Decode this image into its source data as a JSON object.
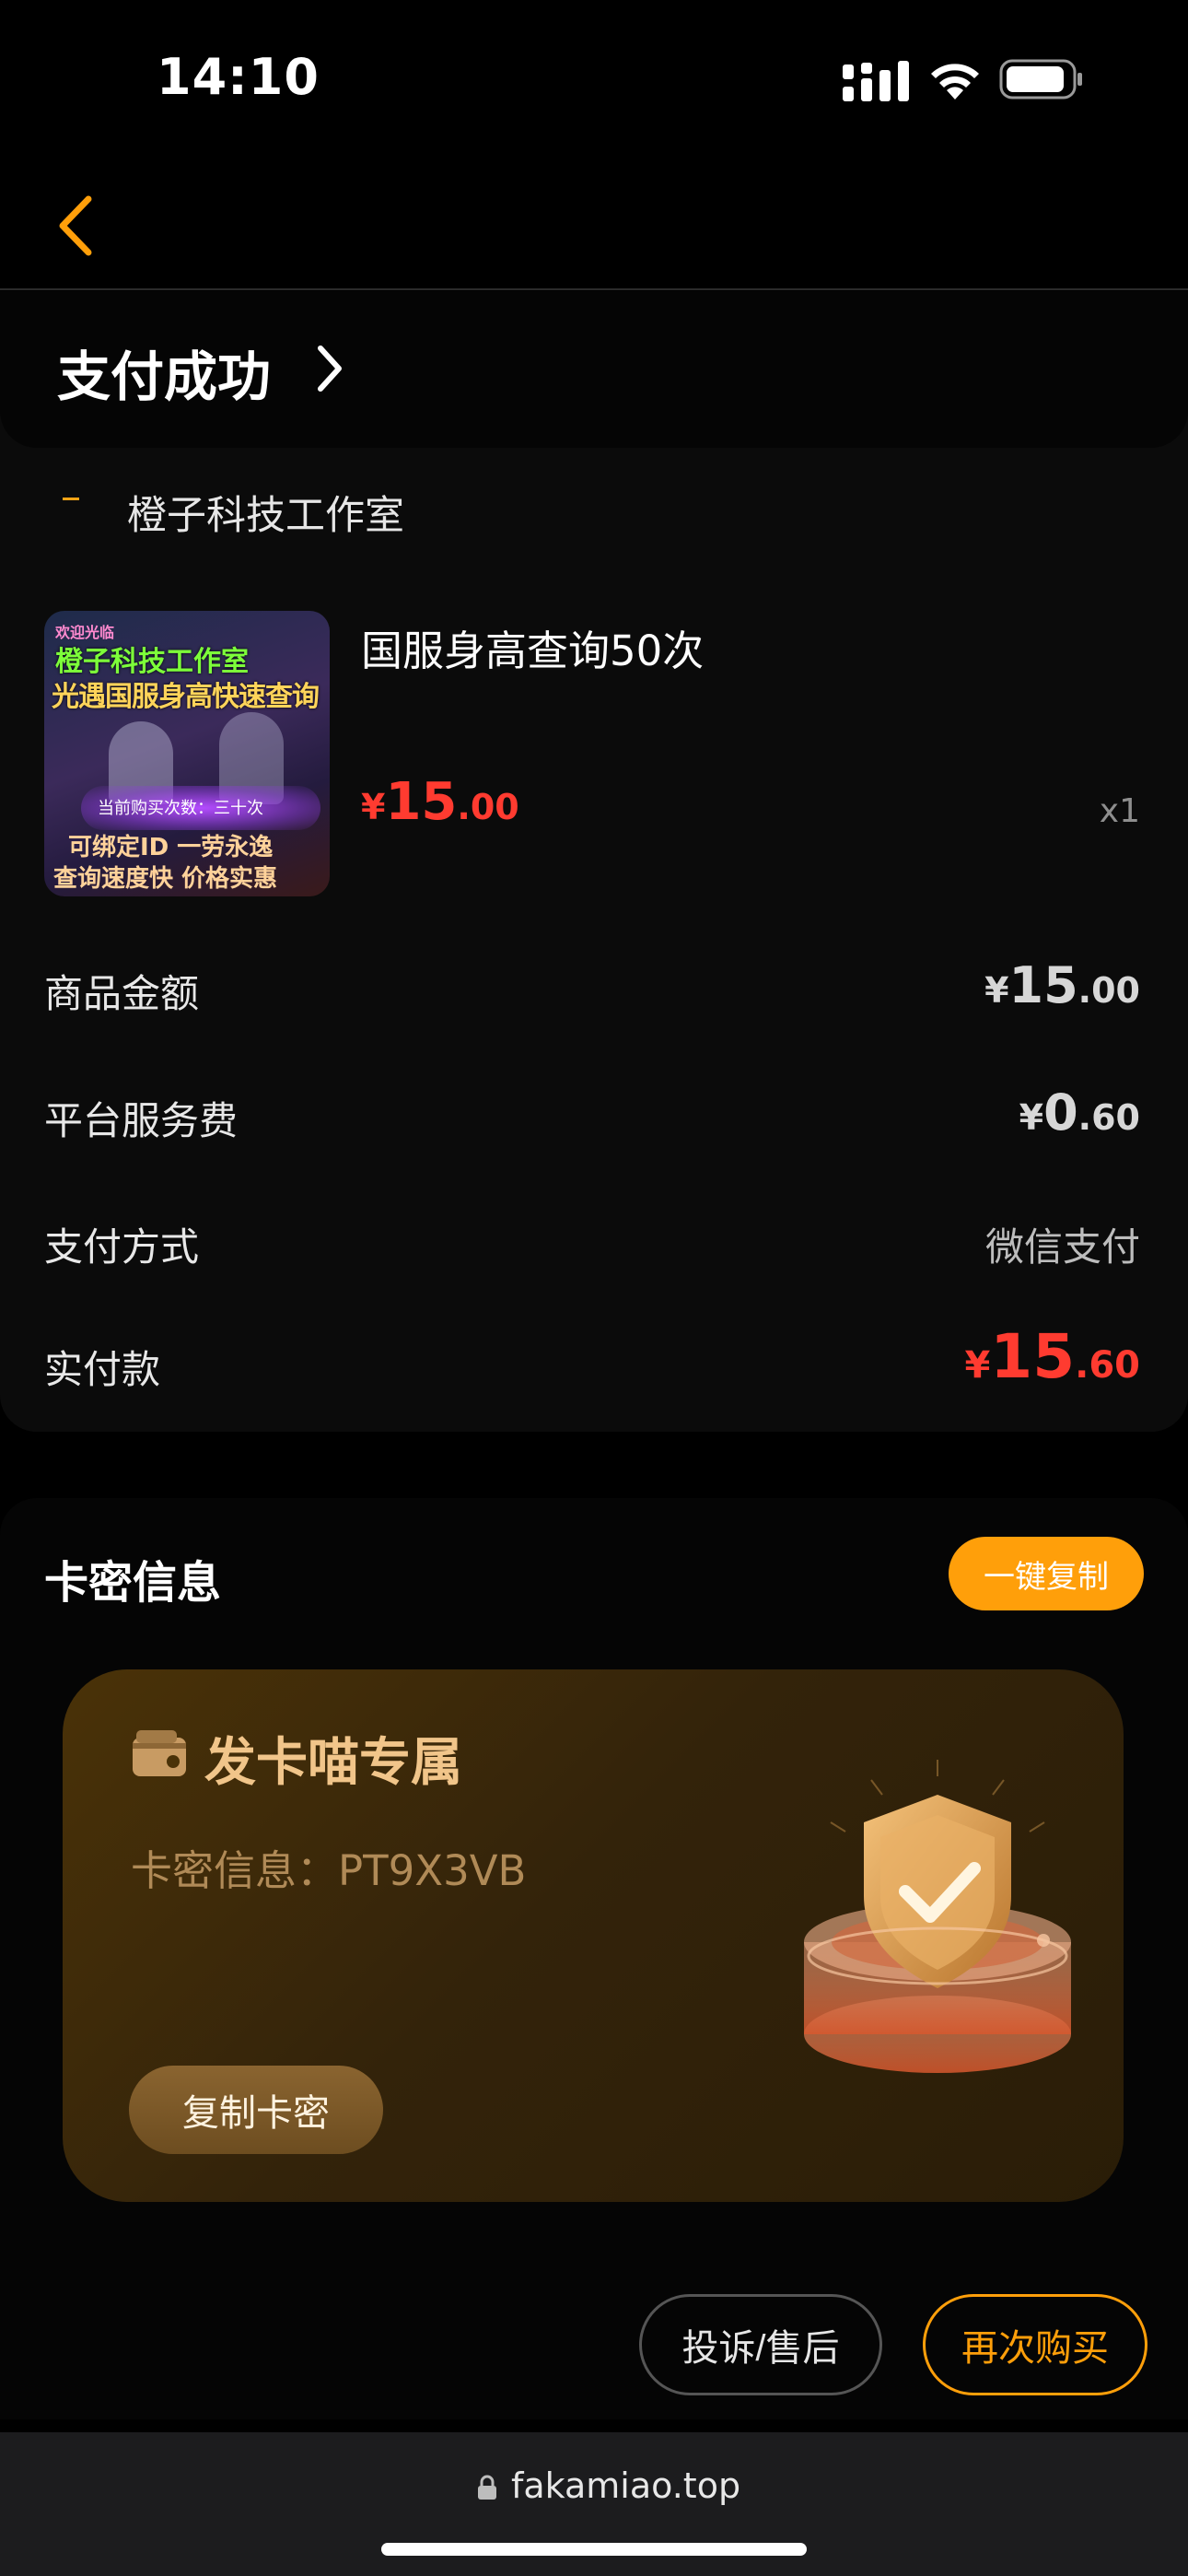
{
  "status_bar": {
    "time": "14:10"
  },
  "nav": {
    "back_icon": "chevron-left-icon"
  },
  "order": {
    "status_title": "支付成功",
    "shop_name": "橙子科技工作室",
    "product": {
      "image_text": {
        "welcome": "欢迎光临",
        "studio": "橙子科技工作室",
        "headline": "光遇国服身高快速查询",
        "remaining": "当前购买次数：三十次",
        "feature1": "可绑定ID 一劳永逸",
        "feature2": "查询速度快 价格实惠"
      },
      "name": "国服身高查询50次",
      "price_symbol": "¥",
      "price_int": "15",
      "price_dec": ".00",
      "qty": "x1"
    },
    "rows": {
      "goods_amount": {
        "label": "商品金额",
        "symbol": "¥",
        "int": "15",
        "dec": ".00"
      },
      "service_fee": {
        "label": "平台服务费",
        "symbol": "¥",
        "int": "0",
        "dec": ".60"
      },
      "pay_method": {
        "label": "支付方式",
        "value": "微信支付"
      },
      "paid": {
        "label": "实付款",
        "symbol": "¥",
        "int": "15",
        "dec": ".60"
      }
    }
  },
  "card_info": {
    "title": "卡密信息",
    "copy_all": "一键复制",
    "voucher": {
      "title": "发卡喵专属",
      "info_label": "卡密信息：",
      "code": "PT9X3VB",
      "copy_button": "复制卡密"
    }
  },
  "actions": {
    "complain": "投诉/售后",
    "rebuy": "再次购买"
  },
  "browser": {
    "url": "fakamiao.top"
  },
  "colors": {
    "accent": "#ff9f0a",
    "price_red": "#ff3b30",
    "background": "#000000"
  }
}
